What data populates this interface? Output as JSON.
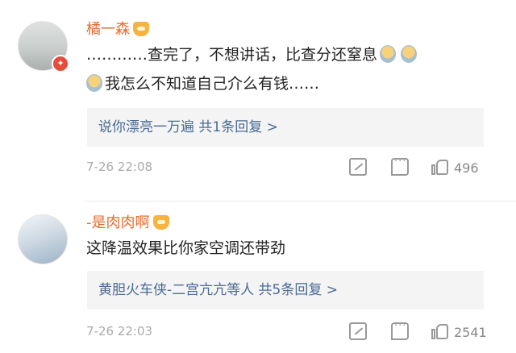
{
  "comments": [
    {
      "username": "橘一森",
      "text_line1_a": "…………查完了，不想讲话，比查分还窒息",
      "text_line2_b": "我怎么不知道自己介么有钱……",
      "reply_summary": "说你漂亮一万遍  共1条回复 >",
      "time": "7-26 22:08",
      "likes": "496"
    },
    {
      "username": "-是肉肉啊",
      "text": "这降温效果比你家空调还带劲",
      "reply_summary": "黄胆火车侠-二宫亢亢等人  共5条回复 >",
      "time": "7-26 22:03",
      "likes": "2541"
    }
  ]
}
